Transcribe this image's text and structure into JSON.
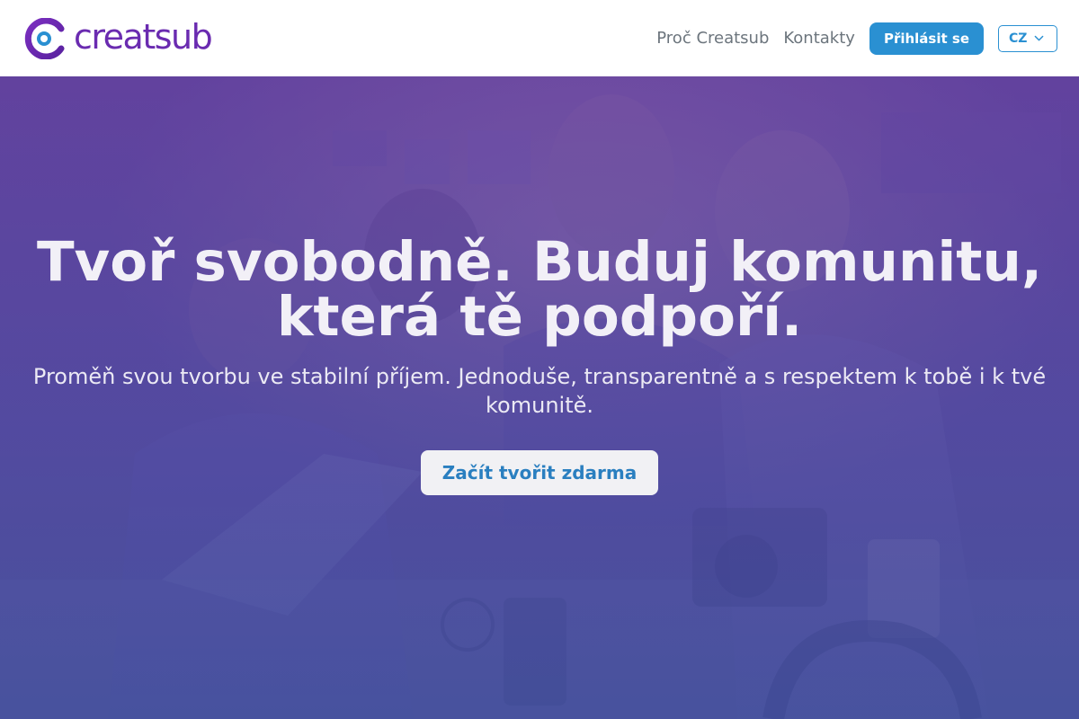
{
  "brand": {
    "name": "creatsub",
    "logo_icon": "creatsub-logo-icon",
    "color": "#6a2bb0"
  },
  "nav": {
    "links": [
      "Proč Creatsub",
      "Kontakty"
    ],
    "login_label": "Přihlásit se",
    "language": "CZ",
    "language_icon": "chevron-down-icon"
  },
  "hero": {
    "title_line1": "Tvoř svobodně. Buduj komunitu,",
    "title_line2": "která tě podpoří.",
    "subtitle": "Proměň svou tvorbu ve stabilní příjem. Jednoduše, transparentně a s respektem k tobě i k tvé komunitě.",
    "cta_label": "Začít tvořit zdarma"
  },
  "colors": {
    "accent": "#2a90d2",
    "overlay": "#5a4aa8",
    "cta_bg": "#f1f1f4"
  }
}
